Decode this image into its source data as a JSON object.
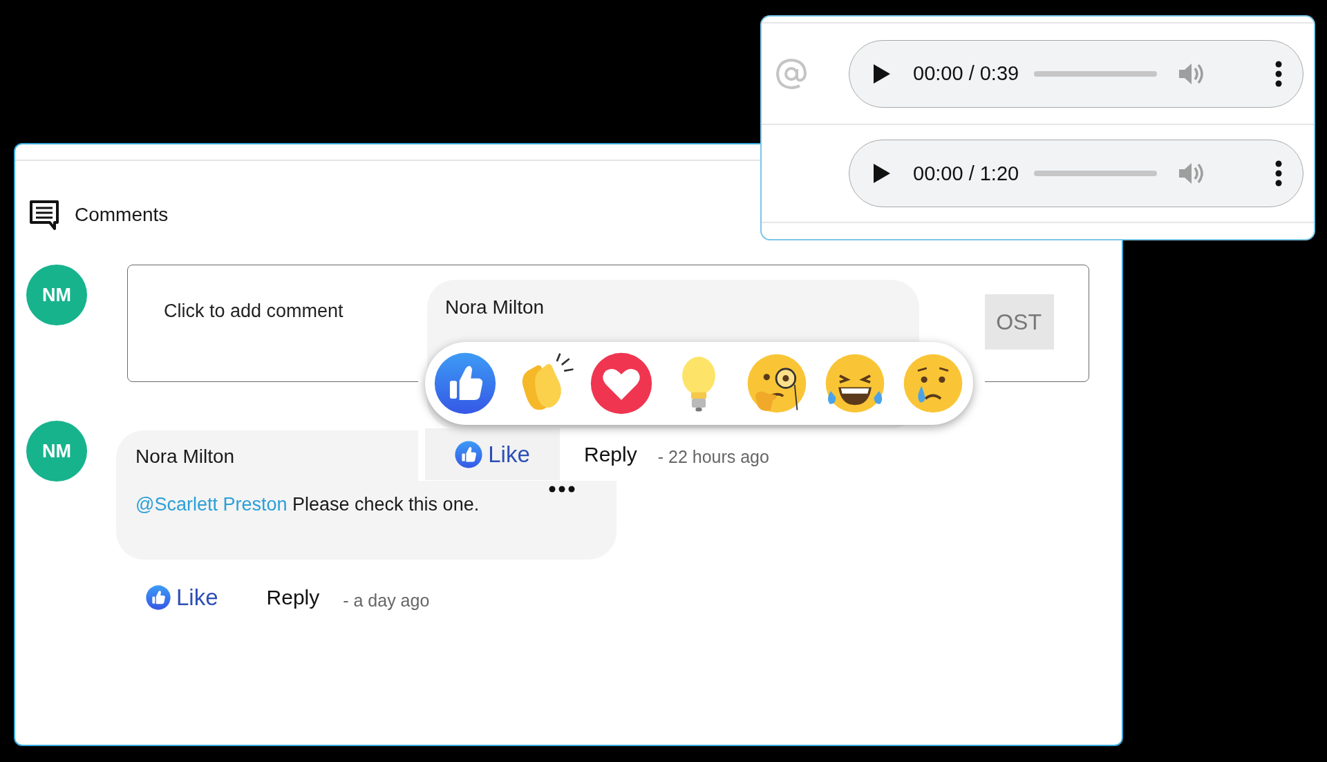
{
  "comments_panel": {
    "title": "Comments",
    "composer": {
      "avatar": "NM",
      "placeholder": "Click to add comment",
      "post_button": "OST"
    },
    "comments": [
      {
        "avatar": "NM",
        "author": "Nora Milton",
        "mention": "@Scarlett Preston",
        "body": "Please check this one.",
        "like": "Like",
        "reply": "Reply",
        "time": "- a day ago"
      }
    ]
  },
  "audio_panel": {
    "players": [
      {
        "time": "00:00 / 0:39"
      },
      {
        "time": "00:00 / 1:20"
      }
    ]
  },
  "reaction_popup": {
    "author": "Nora Milton",
    "reactions": [
      {
        "kind": "like"
      },
      {
        "kind": "clap"
      },
      {
        "kind": "love"
      },
      {
        "kind": "idea"
      },
      {
        "kind": "curious"
      },
      {
        "kind": "haha"
      },
      {
        "kind": "sad"
      }
    ],
    "like": "Like",
    "reply": "Reply",
    "time": "- 22 hours ago"
  }
}
